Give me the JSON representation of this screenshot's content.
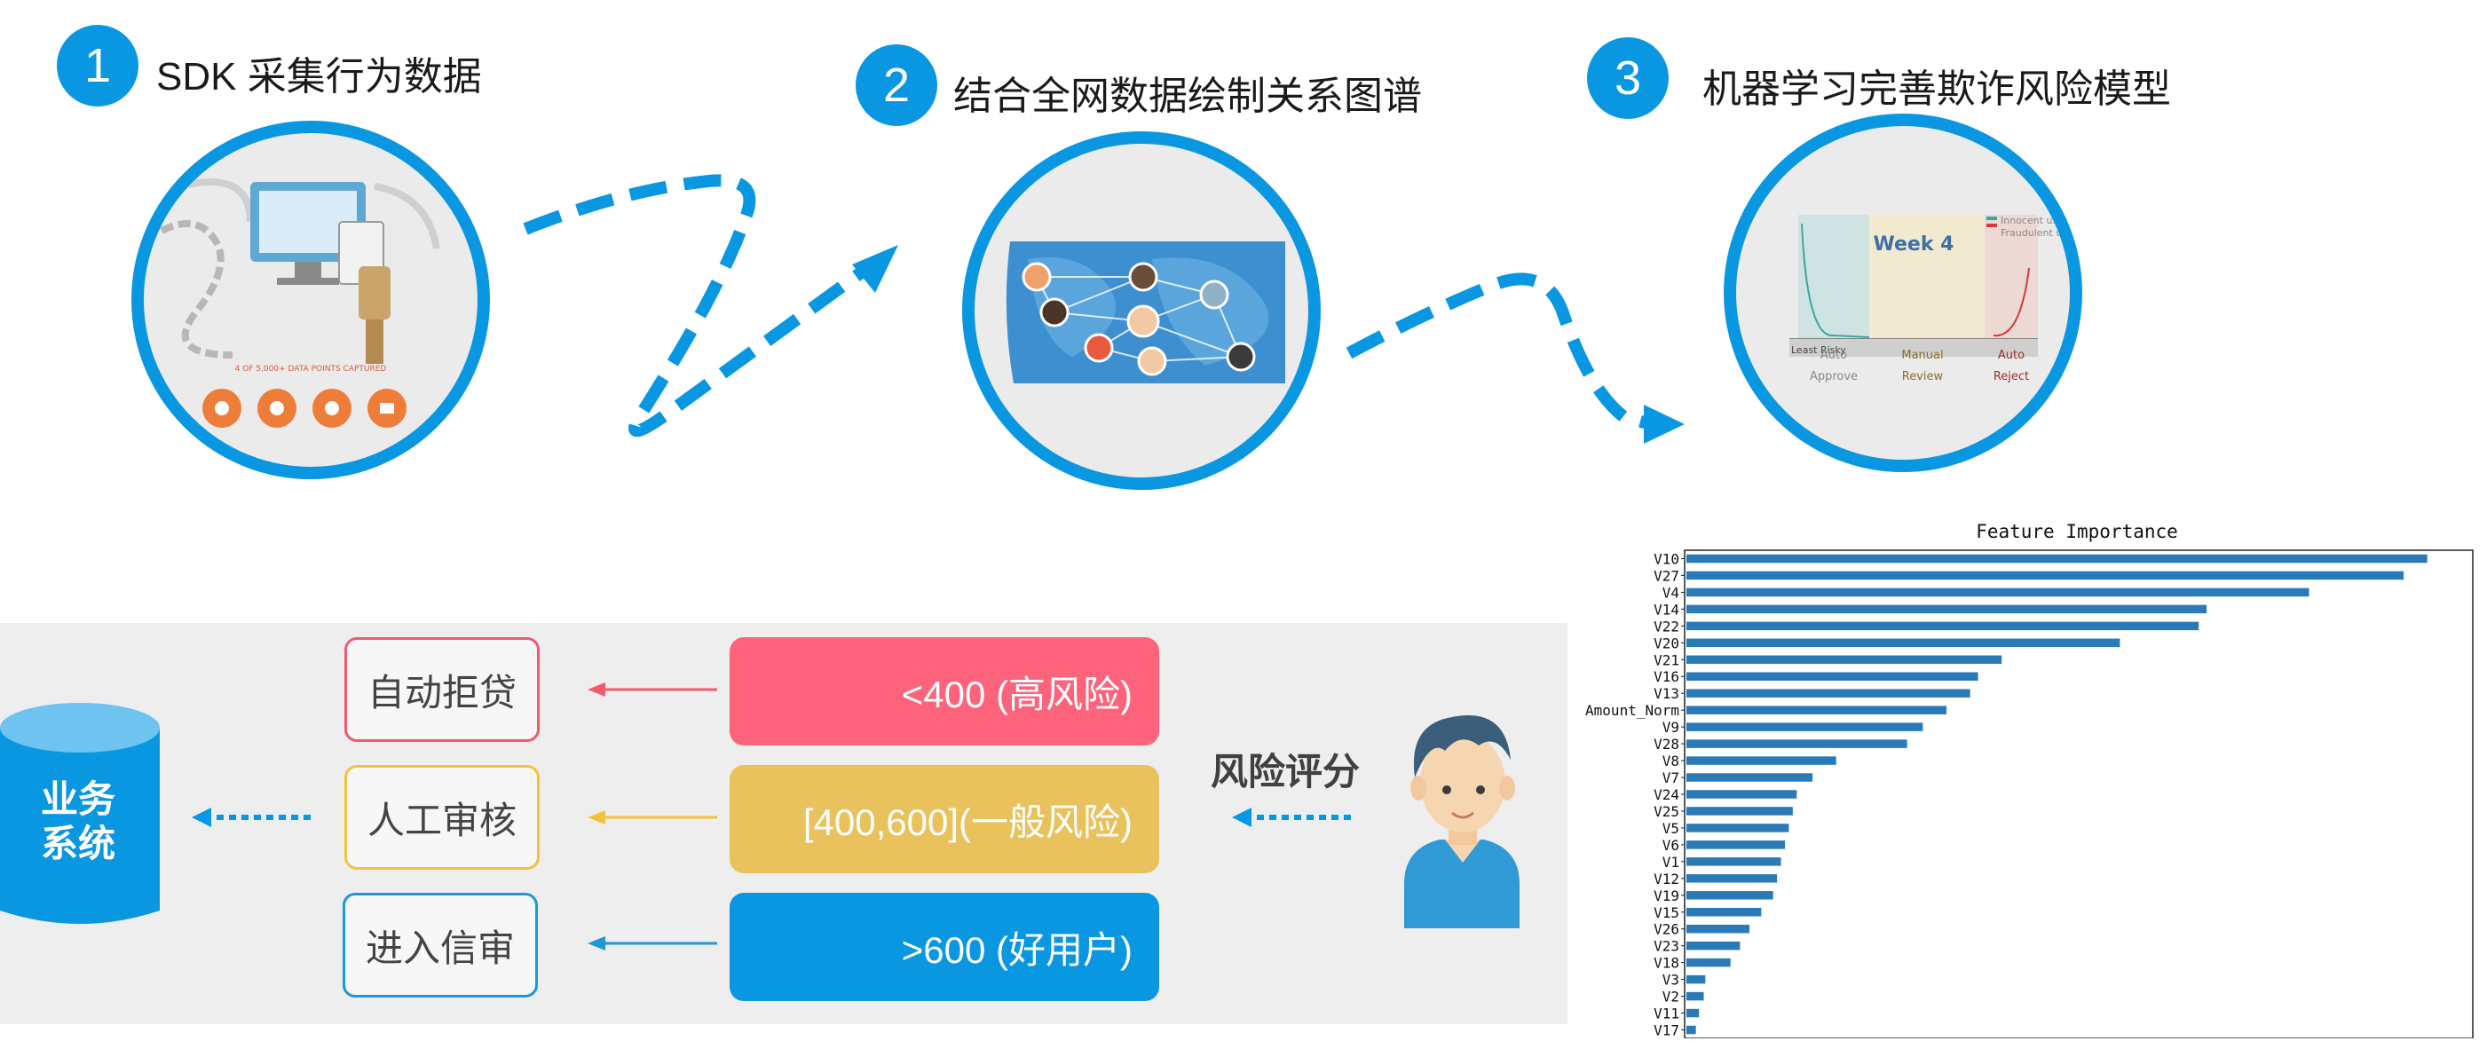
{
  "steps": [
    {
      "number": "1",
      "title": "SDK 采集行为数据"
    },
    {
      "number": "2",
      "title": "结合全网数据绘制关系图谱"
    },
    {
      "number": "3",
      "title": "机器学习完善欺诈风险模型"
    }
  ],
  "illustration1": {
    "caption": "4 OF 5,000+ DATA POINTS CAPTURED"
  },
  "illustration3": {
    "week_label": "Week 4",
    "legend": [
      "Innocent users",
      "Fraudulent users"
    ],
    "axis_label": "Least Risky",
    "zones": [
      "Auto\nApprove",
      "Manual\nReview",
      "Auto\nReject"
    ],
    "zone_a": "Auto",
    "zone_a2": "Approve",
    "zone_b": "Manual",
    "zone_b2": "Review",
    "zone_c": "Auto",
    "zone_c2": "Reject"
  },
  "flow": {
    "system_label_1": "业务",
    "system_label_2": "系统",
    "decisions": [
      "自动拒贷",
      "人工审核",
      "进入信审"
    ],
    "scores": [
      "<400 (高风险)",
      "[400,600](一般风险)",
      ">600 (好用户)"
    ],
    "risk_score_label": "风险评分",
    "colors": {
      "high": "#fe637c",
      "mid": "#e9c25d",
      "good": "#0a97e2",
      "accent": "#0a97e2"
    }
  },
  "chart_data": {
    "type": "bar",
    "orientation": "horizontal",
    "title": "Feature Importance",
    "categories": [
      "V10",
      "V27",
      "V4",
      "V14",
      "V22",
      "V20",
      "V21",
      "V16",
      "V13",
      "Amount_Norm",
      "V9",
      "V28",
      "V8",
      "V7",
      "V24",
      "V25",
      "V5",
      "V6",
      "V1",
      "V12",
      "V19",
      "V15",
      "V26",
      "V23",
      "V18",
      "V3",
      "V2",
      "V11",
      "V17"
    ],
    "values": [
      0.94,
      0.91,
      0.79,
      0.66,
      0.65,
      0.55,
      0.4,
      0.37,
      0.36,
      0.33,
      0.3,
      0.28,
      0.19,
      0.16,
      0.14,
      0.135,
      0.13,
      0.125,
      0.12,
      0.115,
      0.11,
      0.095,
      0.08,
      0.068,
      0.056,
      0.024,
      0.022,
      0.016,
      0.012
    ],
    "xlim": [
      0,
      1
    ],
    "color": "#2a7ab8"
  }
}
